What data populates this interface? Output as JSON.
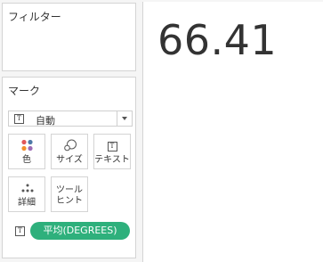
{
  "filters": {
    "title": "フィルター"
  },
  "marks": {
    "title": "マーク",
    "mark_type": {
      "selected": "自動"
    },
    "buttons": {
      "color": "色",
      "size": "サイズ",
      "text": "テキスト",
      "detail": "詳細",
      "tooltip_line1": "ツール",
      "tooltip_line2": "ヒント"
    },
    "fields": [
      {
        "label": "平均(DEGREES)"
      }
    ]
  },
  "icons": {
    "text_mark": "text-box-icon",
    "color": "color-dots-icon",
    "size": "size-circles-icon",
    "detail": "detail-dots-icon",
    "dropdown": "chevron-down-icon"
  },
  "colors": {
    "pill": "#2eb07c"
  },
  "viz": {
    "value": "66.41"
  }
}
